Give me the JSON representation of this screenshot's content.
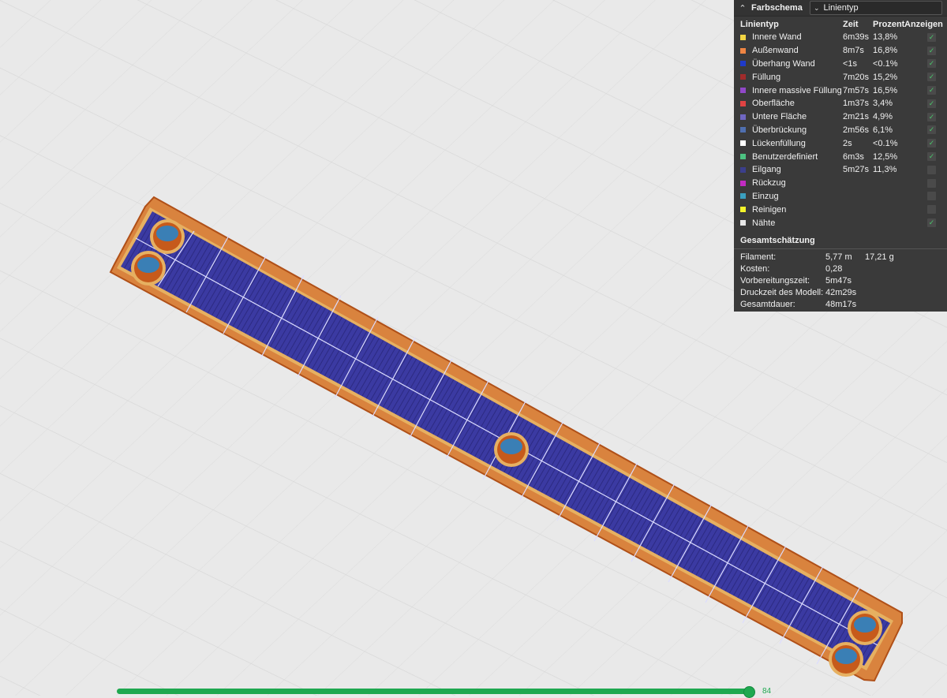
{
  "legend": {
    "header_title": "Farbschema",
    "scheme_value": "Linientyp",
    "columns": {
      "type": "Linientyp",
      "time": "Zeit",
      "percent": "Prozent",
      "show": "Anzeigen"
    },
    "rows": [
      {
        "label": "Innere Wand",
        "time": "6m39s",
        "percent": "13,8%",
        "color": "#f2d544",
        "checked": true
      },
      {
        "label": "Außenwand",
        "time": "8m7s",
        "percent": "16,8%",
        "color": "#ef8543",
        "checked": true
      },
      {
        "label": "Überhang Wand",
        "time": "<1s",
        "percent": "<0.1%",
        "color": "#1f3ac9",
        "checked": true
      },
      {
        "label": "Füllung",
        "time": "7m20s",
        "percent": "15,2%",
        "color": "#a12b2b",
        "checked": true
      },
      {
        "label": "Innere massive Füllung",
        "time": "7m57s",
        "percent": "16,5%",
        "color": "#9148c9",
        "checked": true
      },
      {
        "label": "Oberfläche",
        "time": "1m37s",
        "percent": "3,4%",
        "color": "#e04343",
        "checked": true
      },
      {
        "label": "Untere Fläche",
        "time": "2m21s",
        "percent": "4,9%",
        "color": "#6f67c2",
        "checked": true
      },
      {
        "label": "Überbrückung",
        "time": "2m56s",
        "percent": "6,1%",
        "color": "#4f6fb0",
        "checked": true
      },
      {
        "label": "Lückenfüllung",
        "time": "2s",
        "percent": "<0.1%",
        "color": "#ffffff",
        "checked": true
      },
      {
        "label": "Benutzerdefiniert",
        "time": "6m3s",
        "percent": "12,5%",
        "color": "#4cc281",
        "checked": true
      },
      {
        "label": "Eilgang",
        "time": "5m27s",
        "percent": "11,3%",
        "color": "#3b3f8c",
        "checked": false
      },
      {
        "label": "Rückzug",
        "time": "",
        "percent": "",
        "color": "#c22bc2",
        "checked": false
      },
      {
        "label": "Einzug",
        "time": "",
        "percent": "",
        "color": "#3aa0c0",
        "checked": false
      },
      {
        "label": "Reinigen",
        "time": "",
        "percent": "",
        "color": "#f4f42a",
        "checked": false
      },
      {
        "label": "Nähte",
        "time": "",
        "percent": "",
        "color": "#e8e8e8",
        "checked": true
      }
    ],
    "summary_title": "Gesamtschätzung",
    "summary": {
      "filament_label": "Filament:",
      "filament_length": "5,77 m",
      "filament_weight": "17,21 g",
      "cost_label": "Kosten:",
      "cost_value": "0,28",
      "prep_label": "Vorbereitungszeit:",
      "prep_value": "5m47s",
      "model_label": "Druckzeit des Modell:",
      "model_value": "42m29s",
      "total_label": "Gesamtdauer:",
      "total_value": "48m17s"
    }
  },
  "layer_slider": {
    "current_layer": "84",
    "fraction": 1.0
  },
  "colors": {
    "wall_orange": "#c65a1b",
    "top_surface": "#3f3aa0",
    "progress_green": "#1fa850"
  }
}
